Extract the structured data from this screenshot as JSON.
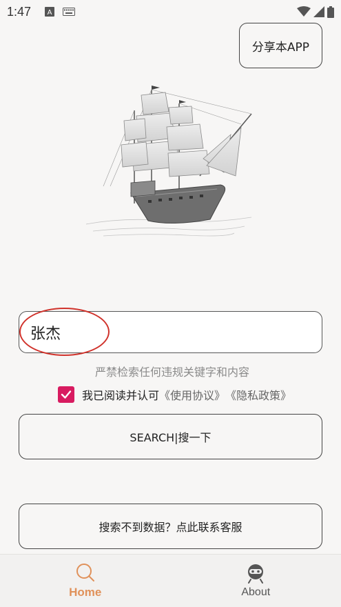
{
  "status_bar": {
    "time": "1:47"
  },
  "header": {
    "share_label": "分享本APP"
  },
  "search": {
    "value": "张杰"
  },
  "notice": {
    "warning": "严禁检索任何违规关键字和内容",
    "agree_prefix": "我已阅读并认可",
    "terms_link": "《使用协议》",
    "privacy_link": "《隐私政策》"
  },
  "actions": {
    "search_label": "SEARCH|搜一下",
    "support_label": "搜索不到数据？点此联系客服"
  },
  "nav": {
    "items": [
      {
        "label": "Home",
        "icon": "search-icon"
      },
      {
        "label": "About",
        "icon": "robot-icon"
      }
    ]
  },
  "colors": {
    "accent": "#e0915a",
    "checkbox": "#d81b60",
    "annotation": "#d0322b"
  }
}
